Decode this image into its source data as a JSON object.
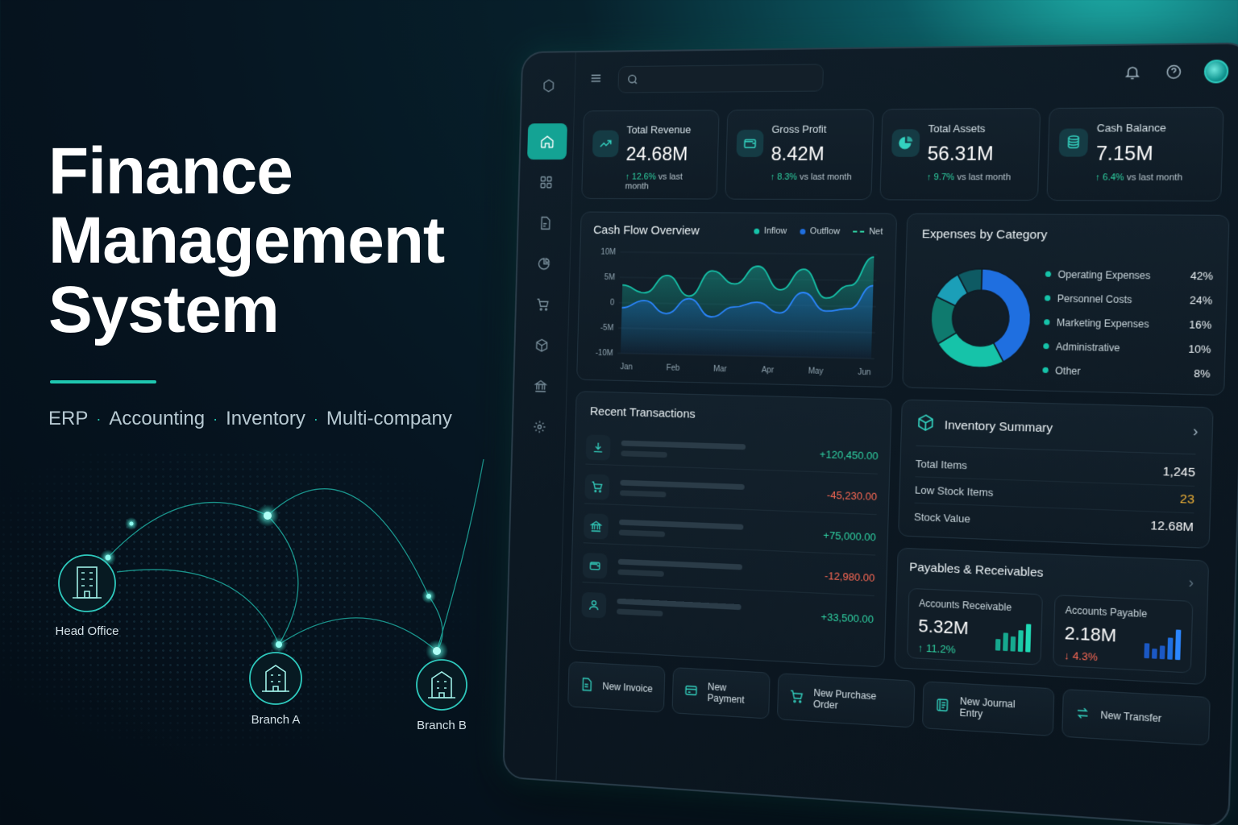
{
  "hero": {
    "title": "Finance\nManagement\nSystem",
    "tags": [
      "ERP",
      "Accounting",
      "Inventory",
      "Multi-company"
    ]
  },
  "network": {
    "nodes": [
      {
        "label": "Head Office"
      },
      {
        "label": "Branch A"
      },
      {
        "label": "Branch B"
      }
    ]
  },
  "colors": {
    "accent": "#1fc7b0",
    "positive": "#2fd3a3",
    "negative": "#ff6a55",
    "warning": "#f2b337",
    "blue": "#1f6fe0"
  },
  "topbar": {
    "search_placeholder": "",
    "icons": [
      "menu-icon",
      "search-icon",
      "bell-icon",
      "help-icon",
      "avatar"
    ]
  },
  "sidebar": {
    "items": [
      {
        "icon": "home-icon",
        "active": true
      },
      {
        "icon": "grid-icon"
      },
      {
        "icon": "document-icon"
      },
      {
        "icon": "pie-chart-icon"
      },
      {
        "icon": "cart-icon"
      },
      {
        "icon": "box-icon"
      },
      {
        "icon": "bank-icon"
      },
      {
        "icon": "gear-icon"
      }
    ]
  },
  "kpis": [
    {
      "title": "Total Revenue",
      "value": "24.68M",
      "change": "12.6%",
      "suffix": "vs last month",
      "icon": "trend-up-icon"
    },
    {
      "title": "Gross Profit",
      "value": "8.42M",
      "change": "8.3%",
      "suffix": "vs last month",
      "icon": "wallet-icon"
    },
    {
      "title": "Total Assets",
      "value": "56.31M",
      "change": "9.7%",
      "suffix": "vs last month",
      "icon": "pie-chart-icon"
    },
    {
      "title": "Cash Balance",
      "value": "7.15M",
      "change": "6.4%",
      "suffix": "vs last month",
      "icon": "coins-icon"
    }
  ],
  "cashflow": {
    "title": "Cash Flow Overview",
    "legend": [
      "Inflow",
      "Outflow",
      "Net"
    ]
  },
  "chart_data": {
    "type": "area",
    "title": "Cash Flow Overview",
    "categories": [
      "Jan",
      "Feb",
      "Mar",
      "Apr",
      "May",
      "Jun"
    ],
    "y_ticks": [
      "10M",
      "5M",
      "0",
      "-5M",
      "-10M"
    ],
    "ylim": [
      -10,
      10
    ],
    "series": [
      {
        "name": "Inflow",
        "values": [
          3.5,
          2.0,
          5.5,
          1.5,
          6.5,
          4.0,
          7.5,
          3.0,
          7.0,
          1.5,
          4.0,
          9.5
        ]
      },
      {
        "name": "Outflow",
        "values": [
          -1.0,
          0.5,
          -2.0,
          1.0,
          -2.5,
          -0.5,
          0.5,
          -1.5,
          2.5,
          -1.0,
          -0.5,
          4.0
        ]
      }
    ],
    "grid": true,
    "legend_position": "top-right"
  },
  "expenses": {
    "title": "Expenses by Category",
    "items": [
      {
        "name": "Operating Expenses",
        "pct": "42%",
        "value": 42,
        "color": "#1f6fe0"
      },
      {
        "name": "Personnel Costs",
        "pct": "24%",
        "value": 24,
        "color": "#16c3a9"
      },
      {
        "name": "Marketing Expenses",
        "pct": "16%",
        "value": 16,
        "color": "#0f7a6e"
      },
      {
        "name": "Administrative",
        "pct": "10%",
        "value": 10,
        "color": "#1b9fb8"
      },
      {
        "name": "Other",
        "pct": "8%",
        "value": 8,
        "color": "#0e5a63"
      }
    ]
  },
  "transactions": {
    "title": "Recent Transactions",
    "rows": [
      {
        "icon": "download-icon",
        "amount": "+120,450.00",
        "type": "pos"
      },
      {
        "icon": "cart-icon",
        "amount": "-45,230.00",
        "type": "neg"
      },
      {
        "icon": "bank-icon",
        "amount": "+75,000.00",
        "type": "pos"
      },
      {
        "icon": "wallet-icon",
        "amount": "-12,980.00",
        "type": "neg"
      },
      {
        "icon": "user-icon",
        "amount": "+33,500.00",
        "type": "pos"
      }
    ]
  },
  "inventory": {
    "title": "Inventory Summary",
    "rows": [
      {
        "label": "Total Items",
        "value": "1,245"
      },
      {
        "label": "Low Stock Items",
        "value": "23"
      },
      {
        "label": "Stock Value",
        "value": "12.68M"
      }
    ]
  },
  "payables": {
    "title": "Payables & Receivables",
    "receivable": {
      "title": "Accounts Receivable",
      "value": "5.32M",
      "change": "11.2%"
    },
    "payable": {
      "title": "Accounts Payable",
      "value": "2.18M",
      "change": "4.3%"
    }
  },
  "actions": [
    {
      "label": "New Invoice",
      "icon": "invoice-icon"
    },
    {
      "label": "New Payment",
      "icon": "card-icon"
    },
    {
      "label": "New Purchase Order",
      "icon": "cart-icon"
    },
    {
      "label": "New Journal Entry",
      "icon": "journal-icon"
    },
    {
      "label": "New Transfer",
      "icon": "transfer-icon"
    }
  ]
}
